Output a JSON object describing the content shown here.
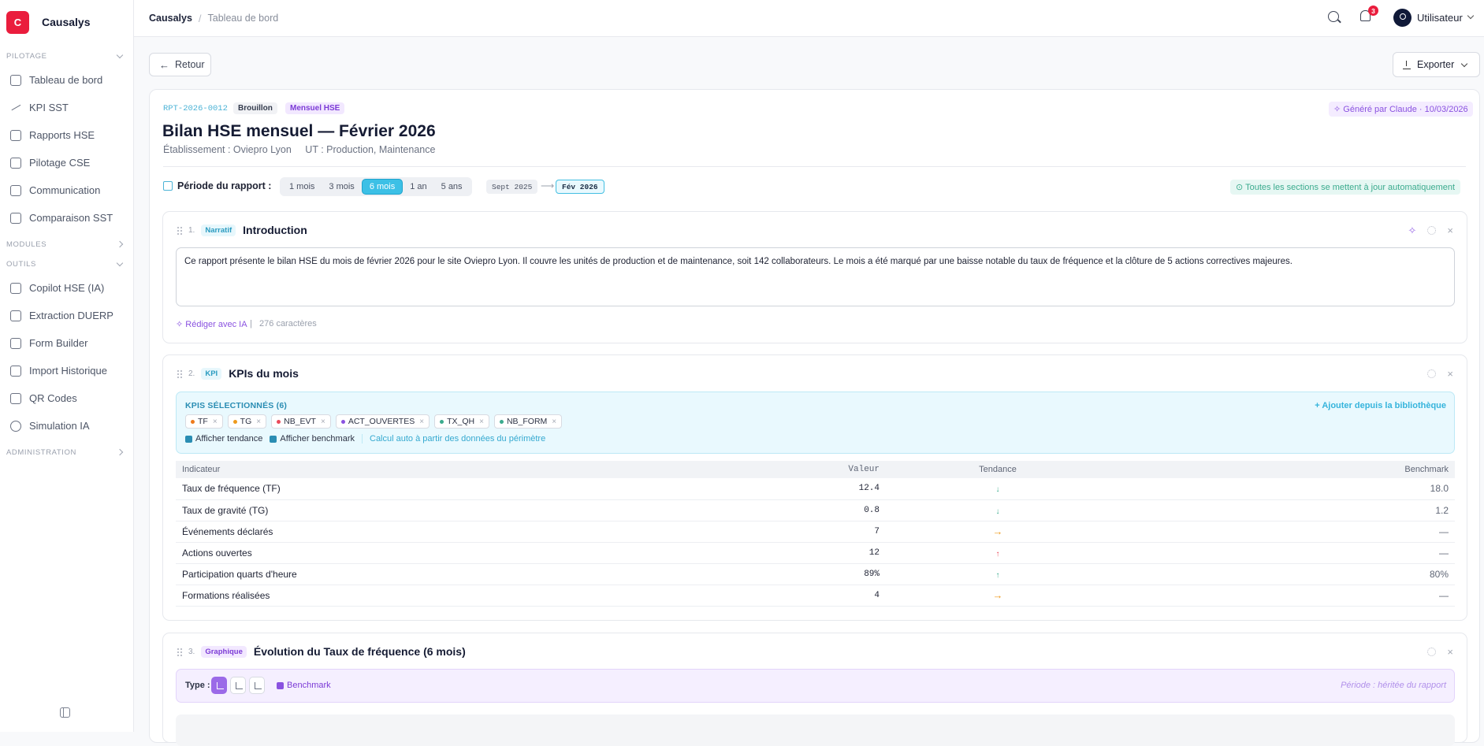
{
  "brand": {
    "logo_letter": "C",
    "name": "Causalys"
  },
  "sidebar": {
    "sections": [
      {
        "label": "PILOTAGE",
        "items": [
          {
            "label": "Tableau de bord",
            "icon": "grid-icon"
          },
          {
            "label": "KPI SST",
            "icon": "trend-icon"
          },
          {
            "label": "Rapports HSE",
            "icon": "document-icon"
          },
          {
            "label": "Pilotage CSE",
            "icon": "users-icon"
          },
          {
            "label": "Communication",
            "icon": "message-icon"
          },
          {
            "label": "Comparaison SST",
            "icon": "compare-icon"
          }
        ]
      },
      {
        "label": "MODULES",
        "items": []
      },
      {
        "label": "OUTILS",
        "items": [
          {
            "label": "Copilot HSE (IA)",
            "icon": "sparkles-icon"
          },
          {
            "label": "Extraction DUERP",
            "icon": "file-import-icon"
          },
          {
            "label": "Form Builder",
            "icon": "form-icon"
          },
          {
            "label": "Import Historique",
            "icon": "file-icon"
          },
          {
            "label": "QR Codes",
            "icon": "qr-code-icon"
          },
          {
            "label": "Simulation IA",
            "icon": "globe-icon"
          }
        ]
      },
      {
        "label": "ADMINISTRATION",
        "items": []
      }
    ]
  },
  "topbar": {
    "breadcrumb": [
      "Causalys",
      "Tableau de bord"
    ],
    "notifications": "3",
    "user": "Utilisateur"
  },
  "actions": {
    "back": "Retour",
    "export": "Exporter"
  },
  "report": {
    "ref": "RPT-2026-0012",
    "status": "Brouillon",
    "type": "Mensuel HSE",
    "generated": "Généré par Claude · 10/03/2026",
    "title": "Bilan HSE mensuel — Février 2026",
    "establishment": "Établissement : Oviepro Lyon",
    "units": "UT : Production, Maintenance",
    "period_label": "Période du rapport :",
    "period_options": [
      "1 mois",
      "3 mois",
      "6 mois",
      "1 an",
      "5 ans"
    ],
    "period_selected": "6 mois",
    "date_from": "Sept 2025",
    "date_to": "Fév 2026",
    "auto_note": "Toutes les sections se mettent à jour automatiquement"
  },
  "sections": [
    {
      "num": "1.",
      "tag": "Narratif",
      "title": "Introduction",
      "text": "Ce rapport présente le bilan HSE du mois de février 2026 pour le site Oviepro Lyon. Il couvre les unités de production et de maintenance, soit 142 collaborateurs. Le mois a été marqué par une baisse notable du taux de fréquence et la clôture de 5 actions correctives majeures.",
      "ai_label": "Rédiger avec IA",
      "char_count": "276 caractères"
    },
    {
      "num": "2.",
      "tag": "KPI",
      "title": "KPIs du mois",
      "selected_label": "KPIS SÉLECTIONNÉS (6)",
      "add_label": "+ Ajouter depuis la bibliothèque",
      "chips": [
        {
          "label": "TF",
          "color": "#ee7a1c"
        },
        {
          "label": "TG",
          "color": "#ee9a1c"
        },
        {
          "label": "NB_EVT",
          "color": "#ea4a5a"
        },
        {
          "label": "ACT_OUVERTES",
          "color": "#8a52e0"
        },
        {
          "label": "TX_QH",
          "color": "#3bab8e"
        },
        {
          "label": "NB_FORM",
          "color": "#3bab8e"
        }
      ],
      "opt_trend": "Afficher tendance",
      "opt_bench": "Afficher benchmark",
      "opt_calc": "Calcul auto à partir des données du périmètre",
      "columns": [
        "Indicateur",
        "Valeur",
        "Tendance",
        "Benchmark"
      ],
      "rows": [
        {
          "name": "Taux de fréquence (TF)",
          "value": "12.4",
          "trend": "↓",
          "trend_class": "dn",
          "bench": "18.0"
        },
        {
          "name": "Taux de gravité (TG)",
          "value": "0.8",
          "trend": "↓",
          "trend_class": "dn",
          "bench": "1.2"
        },
        {
          "name": "Événements déclarés",
          "value": "7",
          "trend": "→",
          "trend_class": "fl",
          "bench": "—"
        },
        {
          "name": "Actions ouvertes",
          "value": "12",
          "trend": "↑",
          "trend_class": "up",
          "bench": "—"
        },
        {
          "name": "Participation quarts d'heure",
          "value": "89%",
          "trend": "↑",
          "trend_class": "ug",
          "bench": "80%"
        },
        {
          "name": "Formations réalisées",
          "value": "4",
          "trend": "→",
          "trend_class": "fl",
          "bench": "—"
        }
      ]
    },
    {
      "num": "3.",
      "tag": "Graphique",
      "title": "Évolution du Taux de fréquence (6 mois)",
      "type_label": "Type :",
      "bench_label": "Benchmark",
      "period_note": "Période : héritée du rapport"
    }
  ]
}
